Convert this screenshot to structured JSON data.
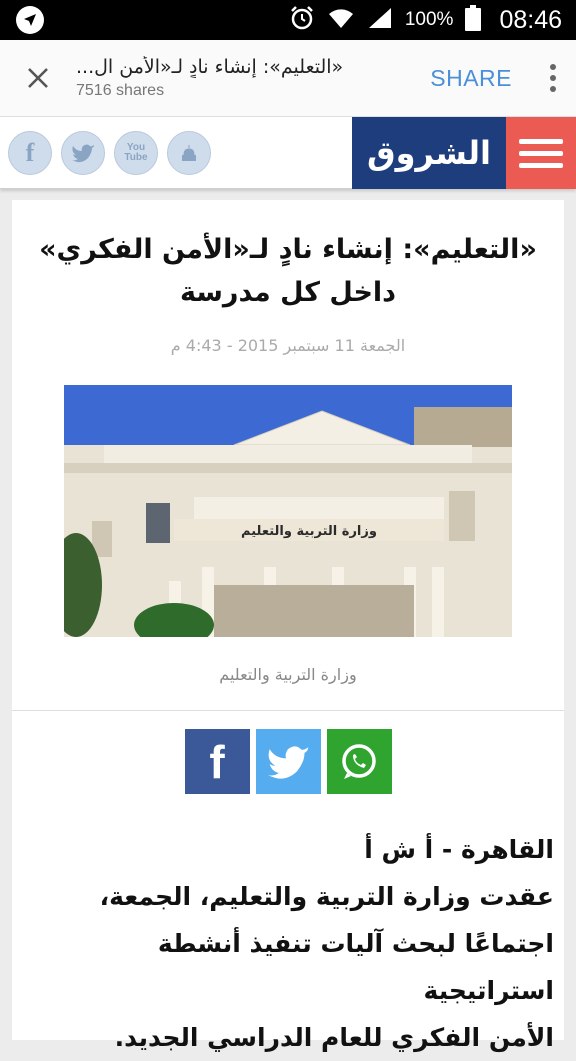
{
  "status_bar": {
    "battery_percent": "100%",
    "time": "08:46"
  },
  "share_bar": {
    "title": "«التعليم»: إنشاء نادٍ لـ«الأمن ال...",
    "shares": "7516 shares",
    "share_label": "SHARE"
  },
  "site_header": {
    "logo_text": "الشروق",
    "social_icons": [
      "facebook-icon",
      "twitter-icon",
      "youtube-icon",
      "mosque-icon"
    ],
    "youtube_text": "You Tube"
  },
  "article": {
    "headline": "«التعليم»: إنشاء نادٍ لـ«الأمن الفكري» داخل كل مدرسة",
    "date": "الجمعة 11 سبتمبر 2015 - 4:43 م",
    "image_sign_text": "وزارة التربية والتعليم",
    "caption": "وزارة التربية والتعليم",
    "body_lines": [
      "القاهرة - أ ش أ",
      "عقدت وزارة التربية والتعليم، الجمعة،",
      "اجتماعًا لبحث آليات تنفيذ أنشطة استراتيجية",
      "الأمن الفكري للعام الدراسي الجديد."
    ]
  },
  "colors": {
    "logo_bg": "#1e3d7c",
    "menu_bg": "#ec5b53",
    "share_blue": "#4a90d9",
    "facebook": "#3b5998",
    "twitter": "#55acee",
    "whatsapp": "#2fa52f"
  }
}
